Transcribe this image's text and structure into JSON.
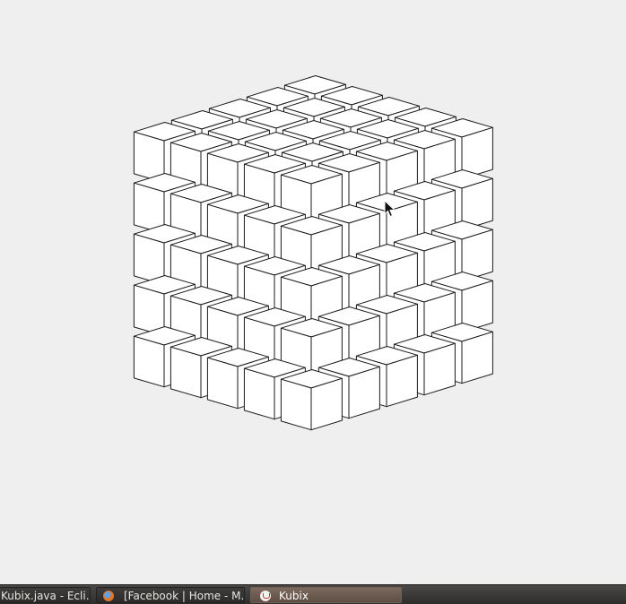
{
  "taskbar": {
    "tasks": [
      {
        "label": "Kubix.java - Ecli...",
        "active": false
      },
      {
        "label": "[Facebook | Home - M...",
        "active": false,
        "icon": "firefox-icon"
      },
      {
        "label": "Kubix",
        "active": true,
        "icon": "java-icon"
      }
    ]
  },
  "colors": {
    "background": "#efefef",
    "cube_face": "#ffffff",
    "cube_edge": "#1a1a1a",
    "taskbar": "#3a3836",
    "active_task": "#6e5a4e"
  },
  "icons": [
    "firefox-icon",
    "java-icon",
    "mouse-cursor-icon"
  ]
}
